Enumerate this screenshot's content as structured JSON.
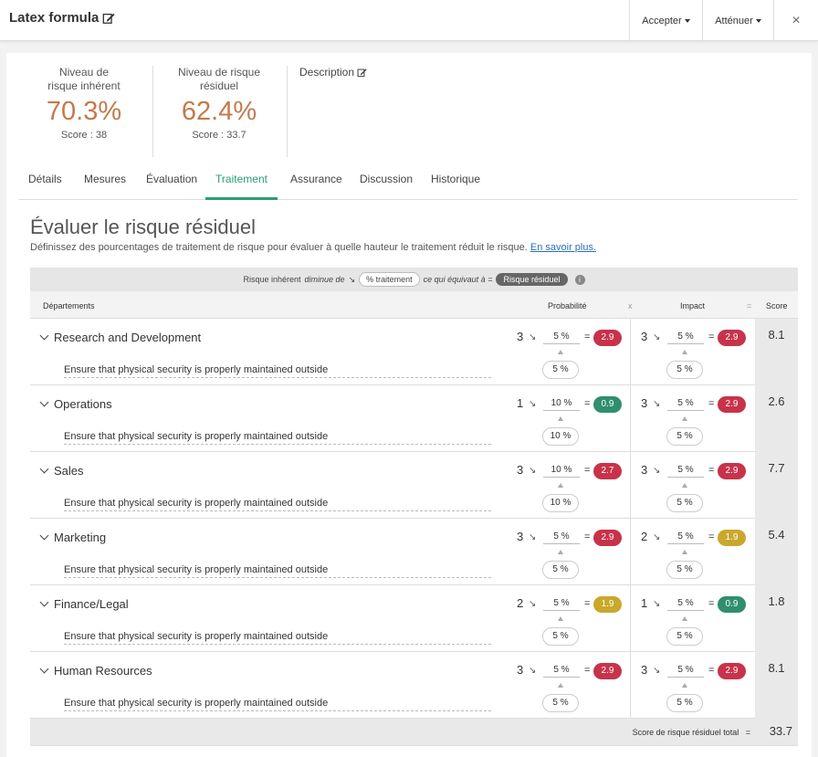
{
  "header": {
    "title": "Latex formula",
    "accept_label": "Accepter",
    "mitigate_label": "Atténuer",
    "close_label": "×"
  },
  "summary": {
    "inherent": {
      "label": "Niveau de risque inhérent",
      "value": "70.3%",
      "score": "Score : 38"
    },
    "residual": {
      "label": "Niveau de risque résiduel",
      "value": "62.4%",
      "score": "Score : 33.7"
    },
    "description_label": "Description"
  },
  "tabs": [
    "Détails",
    "Mesures",
    "Évaluation",
    "Traitement",
    "Assurance",
    "Discussion",
    "Historique"
  ],
  "active_tab": "Traitement",
  "section": {
    "title": "Évaluer le risque résiduel",
    "intro": "Définissez des pourcentages de traitement de risque pour évaluer à quelle hauteur le traitement réduit le risque.",
    "learn_more": "En savoir plus."
  },
  "formula": {
    "part1": "Risque inhérent",
    "part2": "diminue de",
    "pill1": "% traitement",
    "part3": "ce qui équivaut à =",
    "pill2": "Risque résiduel",
    "info": "i"
  },
  "columns": {
    "departments": "Départements",
    "probability": "Probabilité",
    "times": "x",
    "impact": "Impact",
    "equals": "=",
    "score": "Score"
  },
  "colors": {
    "red": "#c7334a",
    "green": "#2f8f6f",
    "yellow": "#c9a82c",
    "accent": "#2a9d7a",
    "kpi": "#c47a4a"
  },
  "rows": [
    {
      "name": "Research and Development",
      "measure": "Ensure that physical security is properly maintained outside",
      "prob": {
        "base": "3",
        "pct": "5 %",
        "result": "2.9",
        "color": "#c7334a",
        "pill": "5 %"
      },
      "impact": {
        "base": "3",
        "pct": "5 %",
        "result": "2.9",
        "color": "#c7334a",
        "pill": "5 %"
      },
      "score": "8.1"
    },
    {
      "name": "Operations",
      "measure": "Ensure that physical security is properly maintained outside",
      "prob": {
        "base": "1",
        "pct": "10 %",
        "result": "0.9",
        "color": "#2f8f6f",
        "pill": "10 %"
      },
      "impact": {
        "base": "3",
        "pct": "5 %",
        "result": "2.9",
        "color": "#c7334a",
        "pill": "5 %"
      },
      "score": "2.6"
    },
    {
      "name": "Sales",
      "measure": "Ensure that physical security is properly maintained outside",
      "prob": {
        "base": "3",
        "pct": "10 %",
        "result": "2.7",
        "color": "#c7334a",
        "pill": "10 %"
      },
      "impact": {
        "base": "3",
        "pct": "5 %",
        "result": "2.9",
        "color": "#c7334a",
        "pill": "5 %"
      },
      "score": "7.7"
    },
    {
      "name": "Marketing",
      "measure": "Ensure that physical security is properly maintained outside",
      "prob": {
        "base": "3",
        "pct": "5 %",
        "result": "2.9",
        "color": "#c7334a",
        "pill": "5 %"
      },
      "impact": {
        "base": "2",
        "pct": "5 %",
        "result": "1.9",
        "color": "#c9a82c",
        "pill": "5 %"
      },
      "score": "5.4"
    },
    {
      "name": "Finance/Legal",
      "measure": "Ensure that physical security is properly maintained outside",
      "prob": {
        "base": "2",
        "pct": "5 %",
        "result": "1.9",
        "color": "#c9a82c",
        "pill": "5 %"
      },
      "impact": {
        "base": "1",
        "pct": "5 %",
        "result": "0.9",
        "color": "#2f8f6f",
        "pill": "5 %"
      },
      "score": "1.8"
    },
    {
      "name": "Human Resources",
      "measure": "Ensure that physical security is properly maintained outside",
      "prob": {
        "base": "3",
        "pct": "5 %",
        "result": "2.9",
        "color": "#c7334a",
        "pill": "5 %"
      },
      "impact": {
        "base": "3",
        "pct": "5 %",
        "result": "2.9",
        "color": "#c7334a",
        "pill": "5 %"
      },
      "score": "8.1"
    }
  ],
  "total": {
    "label": "Score de risque résiduel total",
    "eq": "=",
    "value": "33.7"
  }
}
